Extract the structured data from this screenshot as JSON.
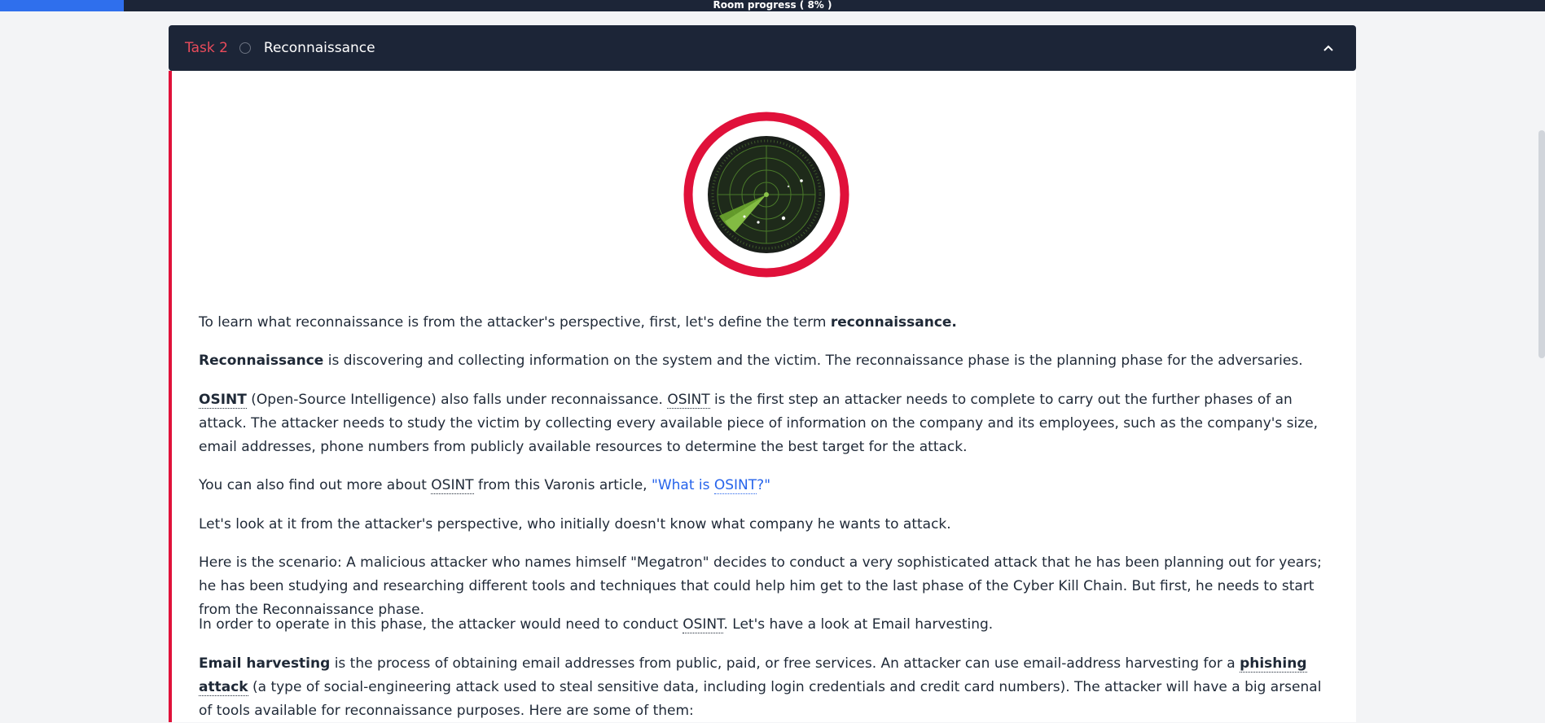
{
  "progress": {
    "label": "Room progress ( 8% )",
    "percent": 8
  },
  "task": {
    "number": "Task 2",
    "title": "Reconnaissance"
  },
  "paragraphs": {
    "p1": {
      "text": "To learn what reconnaissance is from the attacker's perspective, first, let's define the term ",
      "bold": "reconnaissance."
    },
    "p2": {
      "bold": "Reconnaissance",
      "text": " is discovering and collecting information on the system and the victim. The reconnaissance phase is the planning phase for the adversaries."
    },
    "p3": {
      "abbr1": "OSINT",
      "text1": " (Open-Source Intelligence) also falls under reconnaissance. ",
      "abbr2": "OSINT",
      "text2": " is the first step an attacker needs to complete to carry out the further phases of an attack. The attacker needs to study the victim by collecting every available piece of information on the company and its employees, such as the company's size, email addresses, phone numbers from publicly available resources to determine the best target for the attack."
    },
    "p4": {
      "text1": "You can also find out more about ",
      "abbr": "OSINT",
      "text2": " from this Varonis article, ",
      "link_pre": "\"What is ",
      "link_abbr": "OSINT",
      "link_post": "?\""
    },
    "p5": {
      "text": "Let's look at it from the attacker's perspective, who initially doesn't know what company he wants to attack."
    },
    "p6": {
      "text": "Here is the scenario: A malicious attacker who names himself \"Megatron\" decides to conduct a very sophisticated attack that he has been planning out for years; he has been studying and researching different tools and techniques that could help him get to the last phase of the Cyber Kill Chain. But first, he needs to start from the Reconnaissance phase."
    },
    "p7": {
      "text1": "In order to operate in this phase, the attacker would need to conduct ",
      "abbr": "OSINT",
      "text2": ".  Let's have a look at Email harvesting."
    },
    "p8": {
      "bold1": "Email harvesting",
      "text1": " is the process of obtaining email addresses from public, paid, or free services. An attacker can use email-address harvesting for a ",
      "bold2": "phishing attack",
      "text2": " (a type of social-engineering attack used to steal sensitive data, including login credentials and credit card numbers). The attacker will have a big arsenal of tools available for reconnaissance purposes. Here are some of them:"
    }
  },
  "colors": {
    "accent": "#e0113a",
    "header_bg": "#1c2537",
    "link": "#2563eb",
    "progress_fill": "#2f6fed"
  },
  "icons": {
    "toggle": "chevron-up-icon",
    "status": "circle-icon",
    "illustration": "radar-icon"
  }
}
